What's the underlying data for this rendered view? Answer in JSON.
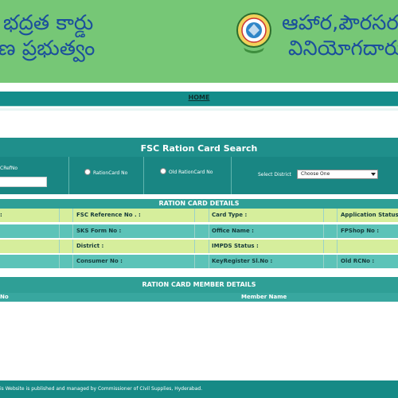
{
  "header": {
    "title_left_line1": "భద్రత కార్డు",
    "title_left_line2": "ణ ప్రభుత్వం",
    "title_right_line1": "ఆహార,పౌరసరఫ",
    "title_right_line2": "వినియోగదారుల",
    "logo_icon": "government-seal-icon",
    "bg_color": "#76c776",
    "text_color": "#1b4f9c"
  },
  "nav": {
    "home_label": "HOME",
    "bg_color": "#138d8a"
  },
  "search": {
    "title": "FSC Ration Card Search",
    "option_refno": "CRefNo",
    "option_rationcard": "RationCard No",
    "option_old_rationcard": "Old RationCard No",
    "district_label": "Select District",
    "district_selected": "Choose One"
  },
  "ration_details": {
    "title": "RATION CARD DETAILS",
    "rows": [
      [
        ":",
        "FSC Reference No . :",
        "Card Type :",
        "Application Status"
      ],
      [
        "",
        "SKS Form No :",
        "Office Name :",
        "FPShop No :"
      ],
      [
        "",
        "District :",
        "IMPDS Status :",
        ""
      ],
      [
        "",
        "Consumer No :",
        "KeyRegister Sl.No :",
        "Old RCNo :"
      ]
    ]
  },
  "member_details": {
    "title": "RATION CARD MEMBER DETAILS",
    "col_no": "No",
    "col_member_name": "Member Name"
  },
  "footer": {
    "text": "is Website is published and managed by Commissioner of Civil Supplies, Hyderabad."
  }
}
